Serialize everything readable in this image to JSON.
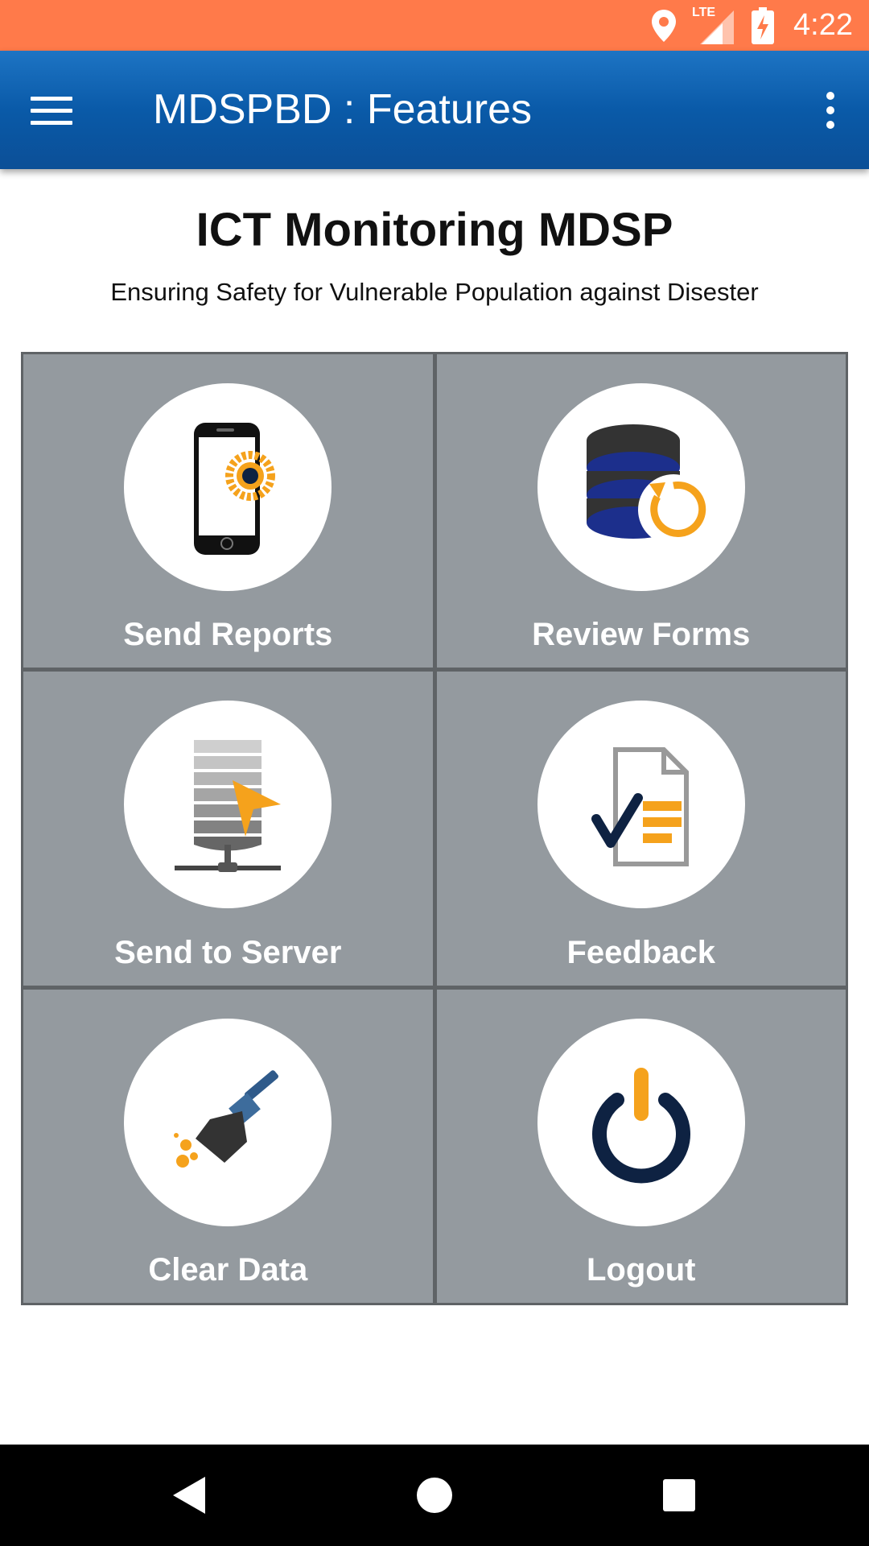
{
  "status_bar": {
    "time": "4:22",
    "network": "LTE",
    "icons": [
      "location-icon",
      "signal-icon",
      "battery-charging-icon"
    ],
    "color": "#ff7a4a"
  },
  "app_bar": {
    "title": "MDSPBD : Features",
    "color": "#0a5aa8",
    "icons": [
      "menu-icon",
      "overflow-menu-icon"
    ]
  },
  "header": {
    "title": "ICT Monitoring MDSP",
    "subtitle": "Ensuring Safety for Vulnerable Population against Disester"
  },
  "tiles": [
    {
      "label": "Send Reports",
      "icon": "phone-gear-icon"
    },
    {
      "label": "Review Forms",
      "icon": "database-refresh-icon"
    },
    {
      "label": "Send to Server",
      "icon": "server-upload-icon"
    },
    {
      "label": "Feedback",
      "icon": "document-check-icon"
    },
    {
      "label": "Clear Data",
      "icon": "broom-icon"
    },
    {
      "label": "Logout",
      "icon": "power-icon"
    }
  ],
  "colors": {
    "tile": "#949a9f",
    "accent_orange": "#f5a21c",
    "navy": "#0e2242"
  },
  "nav_bar": {
    "icons": [
      "back-icon",
      "home-icon",
      "recents-icon"
    ]
  }
}
